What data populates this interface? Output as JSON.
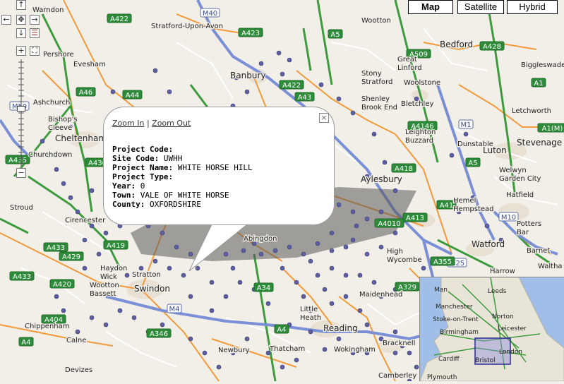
{
  "map_types": [
    {
      "label": "Map",
      "active": true
    },
    {
      "label": "Satellite",
      "active": false
    },
    {
      "label": "Hybrid",
      "active": false
    }
  ],
  "places": [
    "Warndon",
    "Stratford-Upon-Avon",
    "Wootton",
    "Pershore",
    "Evesham",
    "Banbury",
    "Stony Stratford",
    "Great Linford",
    "Bedford",
    "Biggleswade",
    "Ashchurch",
    "Shenley Brook End",
    "Woolstone",
    "Bletchley",
    "Bishop's Cleeve",
    "Cheltenham",
    "Letchworth",
    "Leighton Buzzard",
    "Dunstable",
    "Stevenage",
    "Churchdown",
    "Luton",
    "Welwyn Garden City",
    "Aylesbury",
    "Hatfield",
    "Stroud",
    "Hemel Hempstead",
    "Cirencester",
    "Potters Bar",
    "Abingdon",
    "Watford",
    "Barnet",
    "High Wycombe",
    "Haydon Wick",
    "Stratton",
    "Harrow",
    "Waltha",
    "Wootton Bassett",
    "Swindon",
    "Maidenhead",
    "Little Heath",
    "Chippenham",
    "Reading",
    "Calne",
    "Newbury",
    "Thatcham",
    "Wokingham",
    "Bracknell",
    "Devizes",
    "Camberley"
  ],
  "roads": [
    "M40",
    "A422",
    "A423",
    "A5",
    "A509",
    "A428",
    "A44",
    "A46",
    "A422",
    "A43",
    "A4146",
    "M1",
    "A1",
    "A1(M)",
    "M50",
    "A435",
    "A436",
    "A418",
    "A5",
    "A41",
    "A413",
    "A4010",
    "M10",
    "A433",
    "A419",
    "A429",
    "M25",
    "A355",
    "A433",
    "A420",
    "M4",
    "A34",
    "A404",
    "A346",
    "A4",
    "A4",
    "A329"
  ],
  "overview_places": [
    "Man",
    "Leeds",
    "Manchester",
    "Norton",
    "Stoke-on-Trent",
    "Birmingham",
    "Leicester",
    "London",
    "Cardiff",
    "Bristol",
    "Plymouth"
  ],
  "zoom_controls": {
    "in": "+",
    "out": "−"
  },
  "info_window": {
    "zoom_in": "Zoom In",
    "separator": "|",
    "zoom_out": "Zoom Out",
    "close": "×",
    "fields": [
      {
        "label": "Project Code:",
        "value": ""
      },
      {
        "label": "Site Code:",
        "value": "UWHH"
      },
      {
        "label": "Project Name:",
        "value": "WHITE HORSE HILL"
      },
      {
        "label": "Project Type:",
        "value": ""
      },
      {
        "label": "Year:",
        "value": "0"
      },
      {
        "label": "Town:",
        "value": "VALE OF WHITE HORSE"
      },
      {
        "label": "County:",
        "value": "OXFORDSHIRE"
      }
    ]
  },
  "colors": {
    "land": "#f2efe8",
    "motorway": "#7b8fd6",
    "primary": "#3d9b3d",
    "a_road": "#f29a3a",
    "minor": "#ffffff",
    "marker": "#5d5fa0",
    "road_label": "#2e8b3a"
  }
}
